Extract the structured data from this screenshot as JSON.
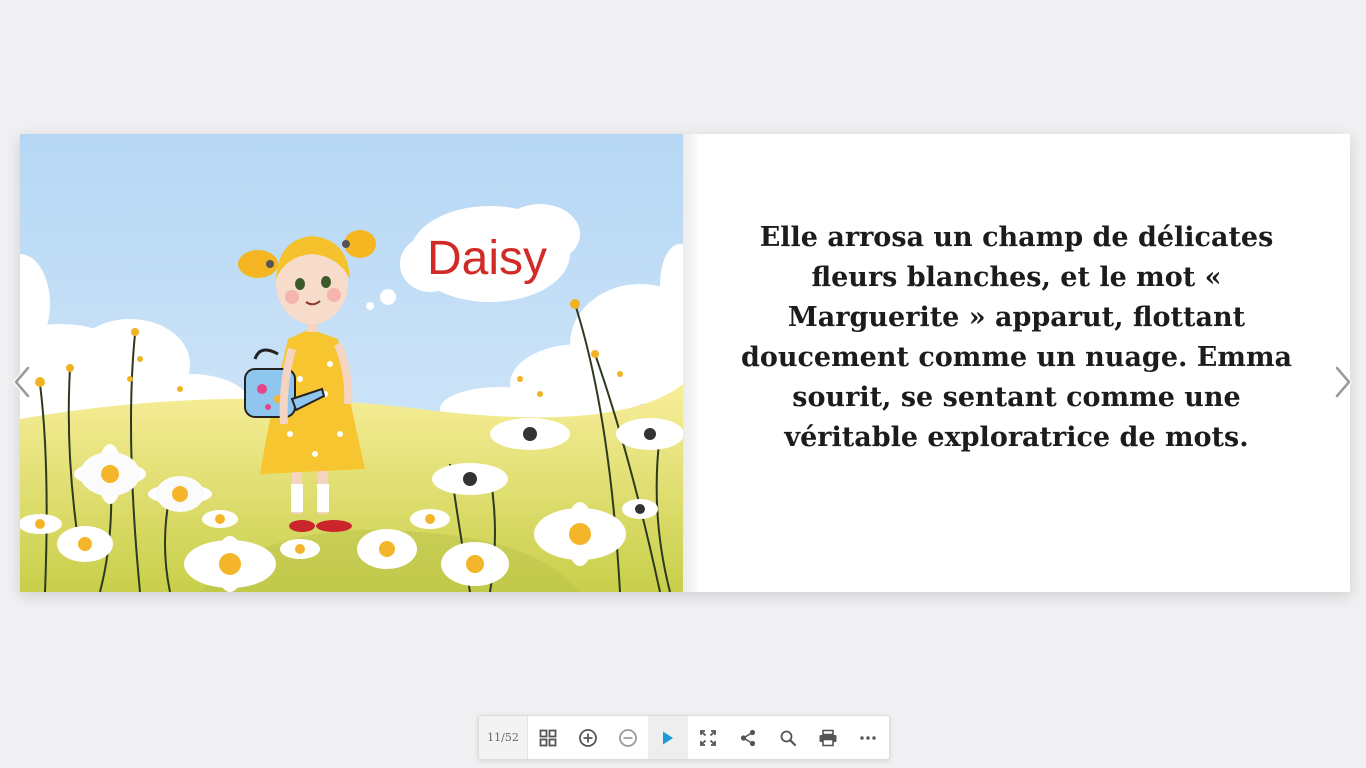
{
  "illustration": {
    "thought_bubble_text": "Daisy"
  },
  "page": {
    "text": "Elle arrosa un champ de délicates fleurs blanches, et le mot « Marguerite » apparut, flottant doucement comme un nuage. Emma sourit, se sentant comme une véritable exploratrice de mots."
  },
  "navigation": {
    "prev_icon": "chevron-left-icon",
    "next_icon": "chevron-right-icon"
  },
  "toolbar": {
    "page_counter": "11/52",
    "buttons": [
      {
        "name": "thumbnails",
        "icon": "grid-icon"
      },
      {
        "name": "zoom-in",
        "icon": "plus-circle-icon"
      },
      {
        "name": "zoom-out",
        "icon": "minus-circle-icon"
      },
      {
        "name": "autoplay",
        "icon": "play-icon"
      },
      {
        "name": "fullscreen",
        "icon": "expand-icon"
      },
      {
        "name": "share",
        "icon": "share-icon"
      },
      {
        "name": "search",
        "icon": "search-icon"
      },
      {
        "name": "print",
        "icon": "print-icon"
      },
      {
        "name": "more",
        "icon": "more-icon"
      }
    ]
  },
  "colors": {
    "background": "#f0f0f2",
    "play_accent": "#1a9ad6",
    "sky": "#bcdcf6",
    "meadow": "#f3e68a",
    "dress": "#f7c530",
    "daisy_title": "#d22a26"
  }
}
